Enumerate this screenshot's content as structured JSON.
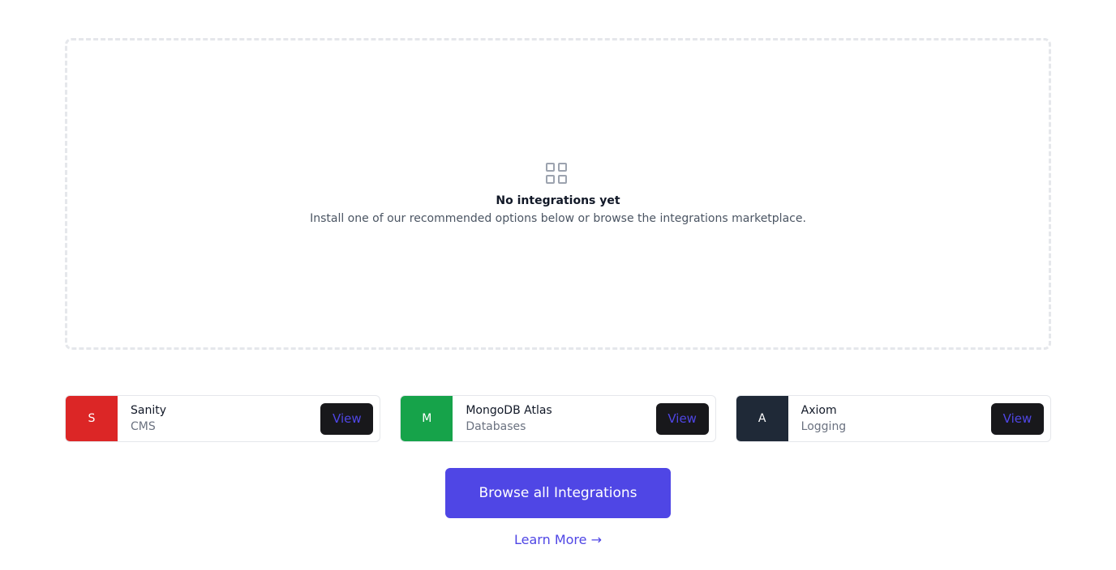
{
  "empty_state": {
    "icon": "grid-icon",
    "title": "No integrations yet",
    "description": "Install one of our recommended options below or browse the integrations marketplace."
  },
  "recommendations": [
    {
      "logo_letter": "S",
      "logo_color": "#dc2626",
      "name": "Sanity",
      "category": "CMS",
      "action_label": "View"
    },
    {
      "logo_letter": "M",
      "logo_color": "#16a34a",
      "name": "MongoDB Atlas",
      "category": "Databases",
      "action_label": "View"
    },
    {
      "logo_letter": "A",
      "logo_color": "#1f2937",
      "name": "Axiom",
      "category": "Logging",
      "action_label": "View"
    }
  ],
  "browse_button_label": "Browse all Integrations",
  "learn_more_label": "Learn More →",
  "colors": {
    "accent": "#4f46e5",
    "view_button_bg": "#18181b"
  }
}
